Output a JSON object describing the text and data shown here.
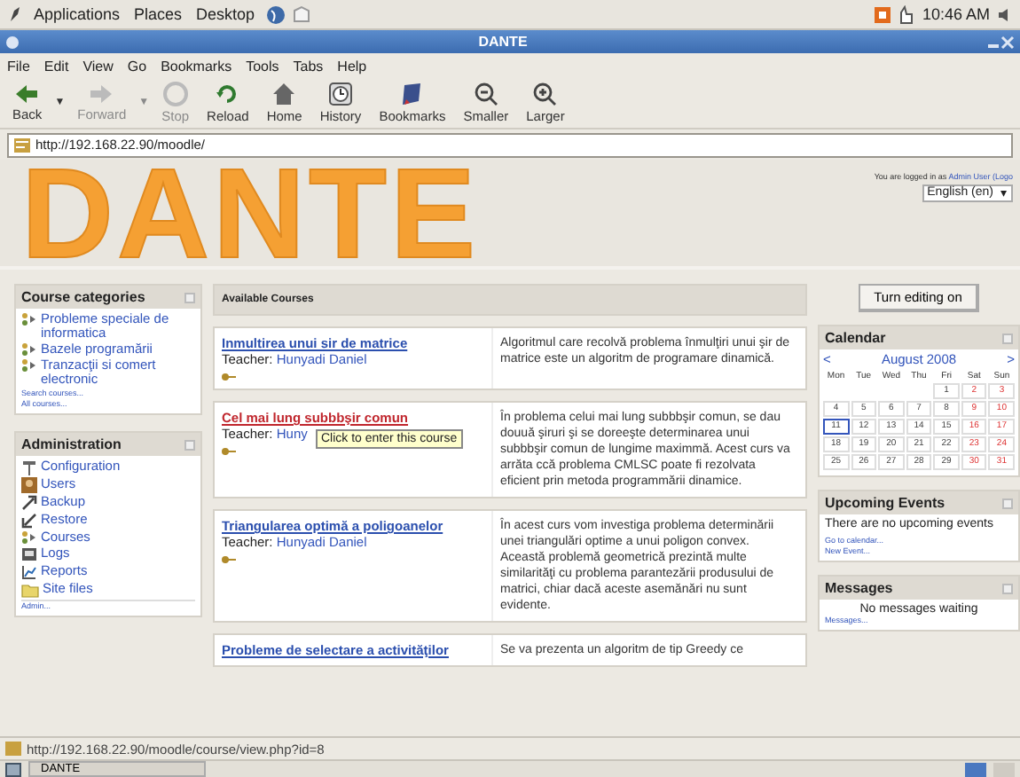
{
  "top_panel": {
    "menus": [
      "Applications",
      "Places",
      "Desktop"
    ],
    "clock": "10:46 AM"
  },
  "window": {
    "title": "DANTE"
  },
  "menu_bar": [
    "File",
    "Edit",
    "View",
    "Go",
    "Bookmarks",
    "Tools",
    "Tabs",
    "Help"
  ],
  "toolbar": [
    {
      "label": "Back",
      "kind": "back",
      "disabled": false,
      "dropdown": "▼"
    },
    {
      "label": "Forward",
      "kind": "forward",
      "disabled": true,
      "dropdown": "▼"
    },
    {
      "label": "Stop",
      "kind": "stop",
      "disabled": true
    },
    {
      "label": "Reload",
      "kind": "reload",
      "disabled": false
    },
    {
      "label": "Home",
      "kind": "home",
      "disabled": false
    },
    {
      "label": "History",
      "kind": "history",
      "disabled": false
    },
    {
      "label": "Bookmarks",
      "kind": "bookmarks",
      "disabled": false
    },
    {
      "label": "Smaller",
      "kind": "zoom-out",
      "disabled": false
    },
    {
      "label": "Larger",
      "kind": "zoom-in",
      "disabled": false
    }
  ],
  "address_bar": {
    "value": "http://192.168.22.90/moodle/"
  },
  "page": {
    "logo": "DANTE",
    "login": {
      "prefix": "You are logged in as",
      "user": "Admin User",
      "logout": "(Logo"
    },
    "language": "English (en)",
    "language_arrow": "▾",
    "course_categories": {
      "title": "Course categories",
      "items": [
        "Probleme speciale de informatica",
        "Bazele programării",
        "Tranzacţii si comert electronic"
      ],
      "links": [
        "Search courses...",
        "All courses..."
      ]
    },
    "administration": {
      "title": "Administration",
      "items": [
        "Configuration",
        "Users",
        "Backup",
        "Restore",
        "Courses",
        "Logs",
        "Reports",
        "Site files"
      ],
      "links": [
        "Admin..."
      ]
    },
    "available_courses": {
      "title": "Available Courses",
      "courses": [
        {
          "name": "Inmultirea unui sir de matrice",
          "teacher_label": "Teacher:",
          "teacher": "Hunyadi Daniel",
          "hovered": false,
          "description": "Algoritmul care recolvă problema înmulţiri unui şir de matrice este un algoritm de programare dinamică."
        },
        {
          "name": "Cel mai lung subbbşir comun",
          "teacher_label": "Teacher:",
          "teacher": "Huny",
          "hovered": true,
          "tooltip": "Click to enter this course",
          "description": "În problema celui mai lung subbbşir comun, se dau douuă şiruri şi se doreeşte determinarea unui subbbşir  comun de lungime maximmă. Acest curs  va arrăta ccă problema CMLSC poate fi rezolvata eficient prin metoda programmării dinamice."
        },
        {
          "name": "Triangularea optimă a poligoanelor",
          "teacher_label": "Teacher:",
          "teacher": "Hunyadi Daniel",
          "hovered": false,
          "description": "În acest curs vom investiga problema determinării unei triangulări optime a unui poligon convex. Această problemă geometrică prezintă multe similarităţi cu problema parantezării produsului de matrici, chiar dacă aceste asemănări nu sunt evidente."
        },
        {
          "name": "Probleme de selectare a activităţilor",
          "hovered": false,
          "description": "Se va prezenta un algoritm de tip Greedy ce"
        }
      ]
    },
    "edit_button": "Turn editing on",
    "calendar": {
      "title": "Calendar",
      "prev": "<",
      "month": "August 2008",
      "next": ">",
      "weekdays": [
        "Mon",
        "Tue",
        "Wed",
        "Thu",
        "Fri",
        "Sat",
        "Sun"
      ],
      "weeks": [
        [
          {
            "d": "1",
            "today": false
          },
          {
            "d": "2",
            "today": false
          },
          {
            "d": "3",
            "today": false
          }
        ],
        [
          {
            "d": "4",
            "today": false
          },
          {
            "d": "5",
            "today": false
          },
          {
            "d": "6",
            "today": false
          },
          {
            "d": "7",
            "today": false
          },
          {
            "d": "8",
            "today": false
          },
          {
            "d": "9",
            "today": false
          },
          {
            "d": "10",
            "today": false
          }
        ],
        [
          {
            "d": "11",
            "today": true
          },
          {
            "d": "12",
            "today": false
          },
          {
            "d": "13",
            "today": false
          },
          {
            "d": "14",
            "today": false
          },
          {
            "d": "15",
            "today": false
          },
          {
            "d": "16",
            "today": false
          },
          {
            "d": "17",
            "today": false
          }
        ],
        [
          {
            "d": "18",
            "today": false
          },
          {
            "d": "19",
            "today": false
          },
          {
            "d": "20",
            "today": false
          },
          {
            "d": "21",
            "today": false
          },
          {
            "d": "22",
            "today": false
          },
          {
            "d": "23",
            "today": false
          },
          {
            "d": "24",
            "today": false
          }
        ],
        [
          {
            "d": "25",
            "today": false
          },
          {
            "d": "26",
            "today": false
          },
          {
            "d": "27",
            "today": false
          },
          {
            "d": "28",
            "today": false
          },
          {
            "d": "29",
            "today": false
          },
          {
            "d": "30",
            "today": false
          },
          {
            "d": "31",
            "today": false
          }
        ]
      ]
    },
    "upcoming_events": {
      "title": "Upcoming Events",
      "text": "There are no upcoming events",
      "links": [
        "Go to calendar...",
        "New Event..."
      ]
    },
    "messages": {
      "title": "Messages",
      "text": "No messages waiting",
      "links": [
        "Messages..."
      ]
    }
  },
  "status_bar": {
    "text": "http://192.168.22.90/moodle/course/view.php?id=8"
  },
  "taskbar": {
    "windows": [
      "DANTE"
    ]
  }
}
